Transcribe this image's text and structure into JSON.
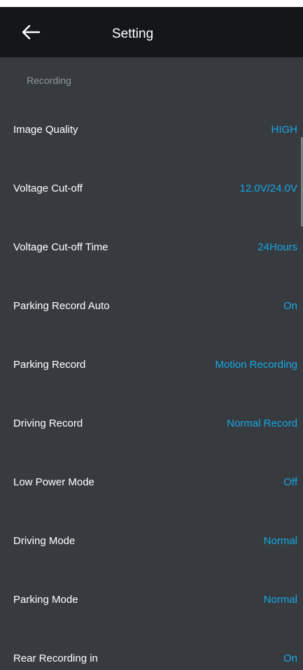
{
  "header": {
    "title": "Setting",
    "back_icon": "arrow-left-icon"
  },
  "section": {
    "title": "Recording"
  },
  "colors": {
    "header_bg": "#14171a",
    "screen_bg": "#373b40",
    "accent": "#16a6e3",
    "section_text": "#8e949b"
  },
  "settings": [
    {
      "label": "Image Quality",
      "value": "HIGH"
    },
    {
      "label": "Voltage Cut-off",
      "value": "12.0V/24.0V"
    },
    {
      "label": "Voltage Cut-off Time",
      "value": "24Hours"
    },
    {
      "label": "Parking Record Auto",
      "value": "On"
    },
    {
      "label": "Parking Record",
      "value": "Motion Recording"
    },
    {
      "label": "Driving Record",
      "value": "Normal Record"
    },
    {
      "label": "Low Power Mode",
      "value": "Off"
    },
    {
      "label": "Driving Mode",
      "value": "Normal"
    },
    {
      "label": "Parking Mode",
      "value": "Normal"
    },
    {
      "label": "Rear Recording in",
      "value": "On"
    }
  ]
}
